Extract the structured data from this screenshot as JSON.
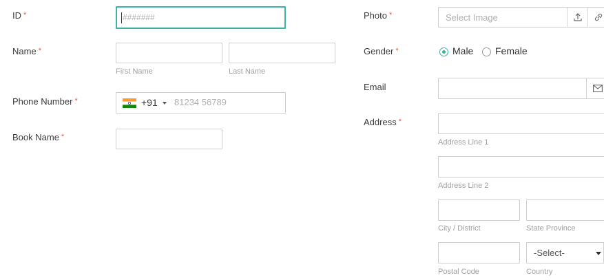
{
  "form": {
    "id": {
      "label": "ID",
      "required": "*",
      "placeholder": "#######"
    },
    "name": {
      "label": "Name",
      "required": "*",
      "first_hint": "First Name",
      "last_hint": "Last Name"
    },
    "phone": {
      "label": "Phone Number",
      "required": "*",
      "country_code": "+91",
      "placeholder": "81234 56789",
      "flag_icon": "india-flag-icon"
    },
    "book": {
      "label": "Book Name",
      "required": "*"
    },
    "photo": {
      "label": "Photo",
      "required": "*",
      "placeholder": "Select Image",
      "upload_icon": "upload-icon",
      "link_icon": "link-icon"
    },
    "gender": {
      "label": "Gender",
      "required": "*",
      "options": [
        "Male",
        "Female"
      ],
      "selected": "Male"
    },
    "email": {
      "label": "Email",
      "icon": "envelope-icon"
    },
    "address": {
      "label": "Address",
      "required": "*",
      "line1_hint": "Address Line 1",
      "line2_hint": "Address Line 2",
      "city_hint": "City / District",
      "state_hint": "State Province",
      "postal_hint": "Postal Code",
      "country_hint": "Country",
      "country_value": "-Select-"
    }
  },
  "colors": {
    "accent": "#3db3a6",
    "required": "#e2574c",
    "border": "#cfcfcf",
    "hint": "#a0a0a0"
  }
}
